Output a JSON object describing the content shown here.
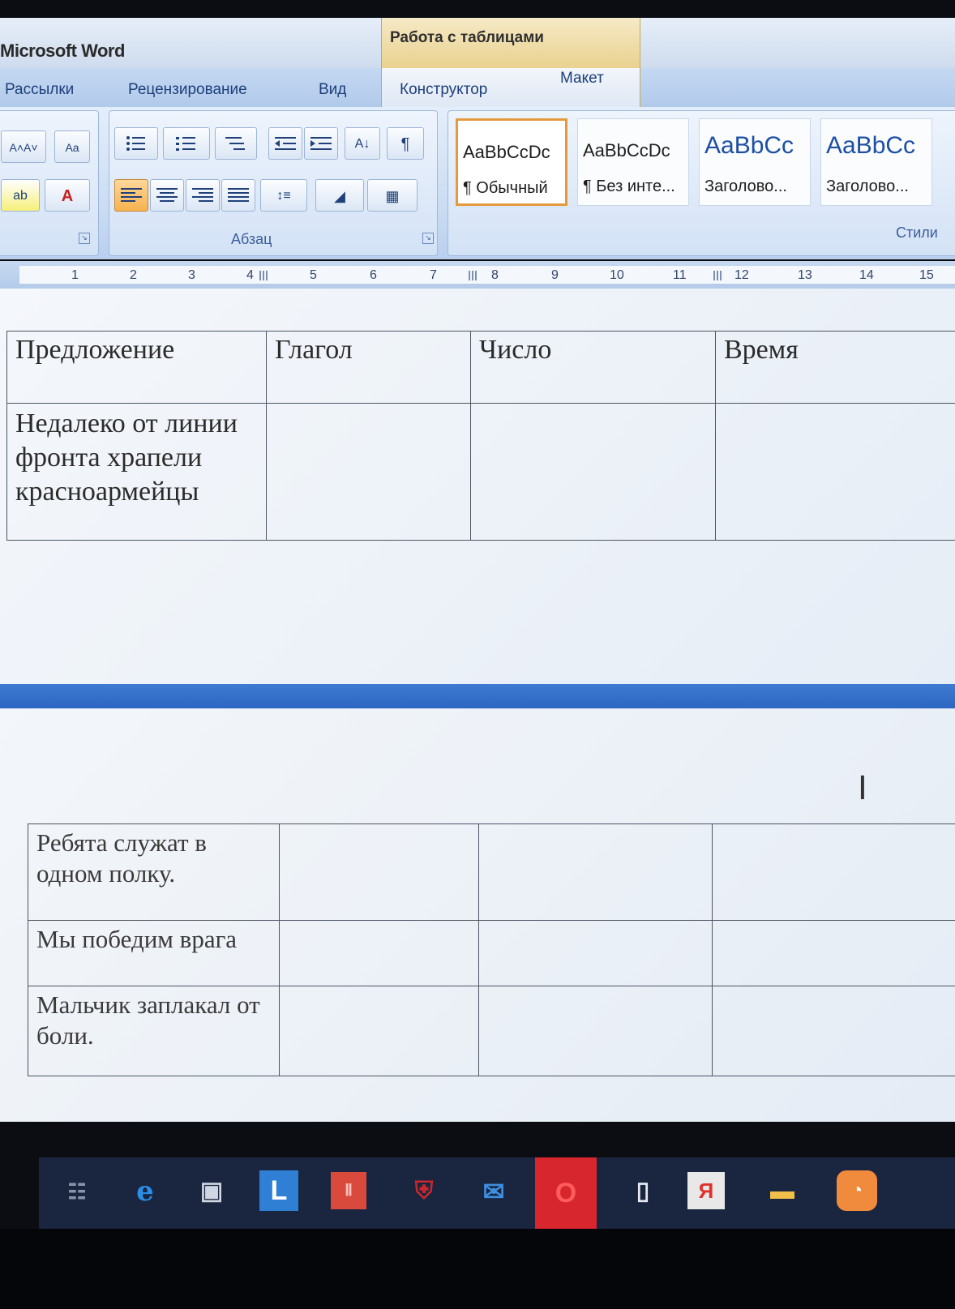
{
  "titlebar": {
    "app_title": "Microsoft Word",
    "context_title": "Работа с таблицами"
  },
  "tabs": [
    "Рассылки",
    "Рецензирование",
    "Вид",
    "Конструктор",
    "Макет"
  ],
  "ribbon": {
    "paragraph_group_label": "Абзац",
    "styles_group_label": "Стили",
    "styles": [
      {
        "sample": "AaBbCcDc",
        "name": "¶ Обычный",
        "selected": true
      },
      {
        "sample": "AaBbCcDc",
        "name": "¶ Без инте...",
        "selected": false
      },
      {
        "sample": "AaBbCc",
        "name": "Заголово...",
        "selected": false
      },
      {
        "sample": "AaBbCc",
        "name": "Заголово...",
        "selected": false
      }
    ],
    "font_color_letter": "A",
    "pilcrow": "¶"
  },
  "ruler": {
    "numbers": [
      "1",
      "2",
      "3",
      "4",
      "5",
      "6",
      "7",
      "8",
      "9",
      "10",
      "11",
      "12",
      "13",
      "14",
      "15"
    ]
  },
  "table1": {
    "headers": [
      "Предложение",
      "Глагол",
      "Число",
      "Время"
    ],
    "rows": [
      [
        "Недалеко от линии фронта храпели красноармейцы",
        "",
        "",
        ""
      ]
    ]
  },
  "table2": {
    "rows": [
      [
        "Ребята служат в одном полку.",
        "",
        "",
        ""
      ],
      [
        "Мы победим врага",
        "",
        "",
        ""
      ],
      [
        "Мальчик заплакал от боли.",
        "",
        "",
        ""
      ]
    ]
  },
  "cursor": "I",
  "taskbar": {
    "icons": [
      "task-view-icon",
      "edge-icon",
      "store-icon",
      "l-app-icon",
      "red-app-icon",
      "mcafee-icon",
      "mail-icon",
      "opera-icon",
      "file-icon",
      "yandex-icon",
      "explorer-icon",
      "media-icon"
    ],
    "labels": {
      "l_app": "L",
      "yandex": "Я"
    }
  },
  "colors": {
    "ribbon_blue": "#c9dbf2",
    "selected_style_border": "#e49a3c",
    "page_gap_blue": "#2c66c1",
    "taskbar": "#1a2540"
  }
}
